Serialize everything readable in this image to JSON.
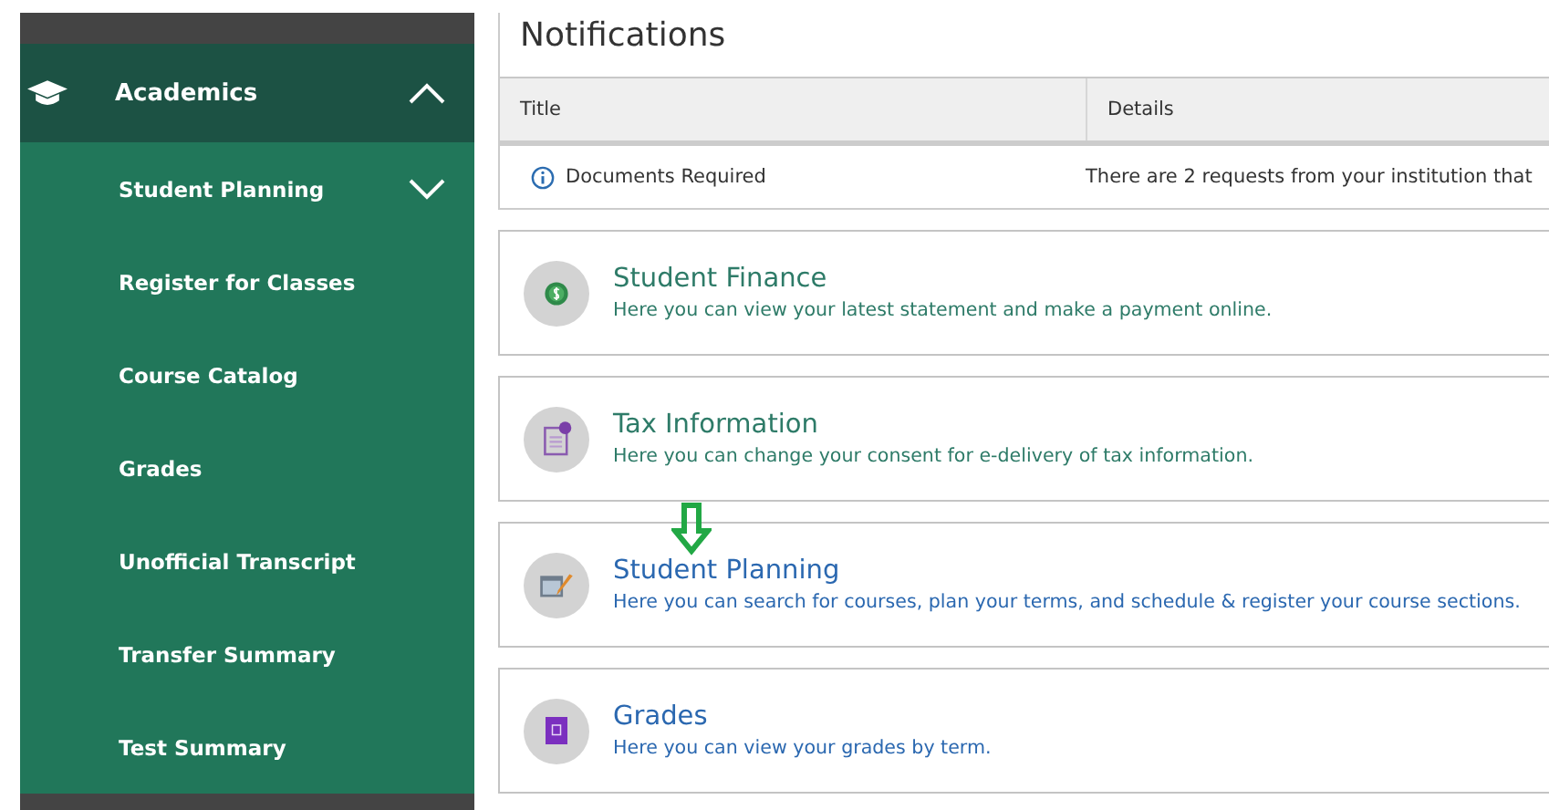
{
  "sidebar": {
    "section": {
      "label": "Academics",
      "expanded": true,
      "children": [
        {
          "label": "Student Planning",
          "expanded": false
        },
        {
          "label": "Register for Classes"
        },
        {
          "label": "Course Catalog"
        },
        {
          "label": "Grades"
        },
        {
          "label": "Unofficial Transcript"
        },
        {
          "label": "Transfer Summary"
        },
        {
          "label": "Test Summary"
        }
      ]
    }
  },
  "notifications": {
    "title": "Notifications",
    "columns": [
      "Title",
      "Details"
    ],
    "rows": [
      {
        "title": "Documents Required",
        "details": "There are 2 requests from your institution that"
      }
    ]
  },
  "cards": [
    {
      "kind": "finance",
      "title": "Student Finance",
      "description": "Here you can view your latest statement and make a payment online.",
      "color": "#2e7b68"
    },
    {
      "kind": "tax",
      "title": "Tax Information",
      "description": "Here you can change your consent for e-delivery of tax information.",
      "color": "#2e7b68"
    },
    {
      "kind": "planning",
      "title": "Student Planning",
      "description": "Here you can search for courses, plan your terms, and schedule & register your course sections.",
      "color": "#2b68b0",
      "pointer": true
    },
    {
      "kind": "grades",
      "title": "Grades",
      "description": "Here you can view your grades by term.",
      "color": "#2b68b0"
    }
  ]
}
